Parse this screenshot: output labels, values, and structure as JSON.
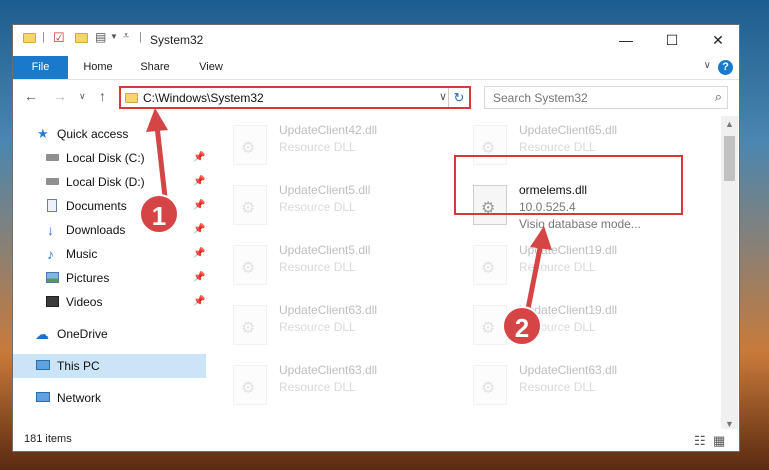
{
  "window": {
    "title": "System32",
    "controls": {
      "minimize": "—",
      "maximize": "☐",
      "close": "✕"
    }
  },
  "ribbon": {
    "tabs": [
      "File",
      "Home",
      "Share",
      "View"
    ],
    "help": "?"
  },
  "address": {
    "path": "C:\\Windows\\System32",
    "search_placeholder": "Search System32"
  },
  "sidebar": {
    "items": [
      {
        "label": "Quick access",
        "icon": "star-icon"
      },
      {
        "label": "Local Disk (C:)",
        "icon": "drive-icon",
        "pinned": true
      },
      {
        "label": "Local Disk (D:)",
        "icon": "drive-icon",
        "pinned": true
      },
      {
        "label": "Documents",
        "icon": "documents-icon",
        "pinned": true
      },
      {
        "label": "Downloads",
        "icon": "download-icon",
        "pinned": true
      },
      {
        "label": "Music",
        "icon": "music-icon",
        "pinned": true
      },
      {
        "label": "Pictures",
        "icon": "pictures-icon",
        "pinned": true
      },
      {
        "label": "Videos",
        "icon": "videos-icon",
        "pinned": true
      },
      {
        "label": "OneDrive",
        "icon": "cloud-icon"
      },
      {
        "label": "This PC",
        "icon": "computer-icon",
        "selected": true
      },
      {
        "label": "Network",
        "icon": "network-icon"
      }
    ]
  },
  "files": {
    "left": [
      {
        "name": "UpdateClient42.dll",
        "desc": "Resource DLL"
      },
      {
        "name": "UpdateClient5.dll",
        "desc": "Resource DLL"
      },
      {
        "name": "UpdateClient5.dll",
        "desc": "Resource DLL"
      },
      {
        "name": "UpdateClient63.dll",
        "desc": "Resource DLL"
      },
      {
        "name": "UpdateClient63.dll",
        "desc": "Resource DLL"
      }
    ],
    "right": [
      {
        "name": "UpdateClient65.dll",
        "desc": "Resource DLL"
      },
      {
        "name": "ormelems.dll",
        "desc": "10.0.525.4",
        "desc2": "Visio database mode..."
      },
      {
        "name": "UpdateClient19.dll",
        "desc": "Resource DLL"
      },
      {
        "name": "UpdateClient19.dll",
        "desc": "Resource DLL"
      },
      {
        "name": "UpdateClient63.dll",
        "desc": "Resource DLL"
      }
    ]
  },
  "status": {
    "items_count": "181 items"
  },
  "callouts": [
    "1",
    "2"
  ],
  "colors": {
    "accent": "#1979ca",
    "highlight": "#d9373a",
    "callout": "#d64545"
  }
}
